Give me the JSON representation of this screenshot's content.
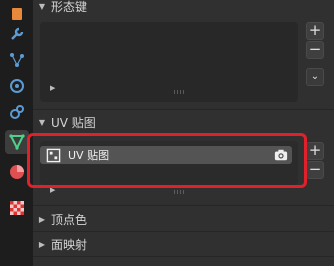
{
  "tabs": [
    {
      "name": "object-data-tab",
      "icon": "object-icon",
      "color": "#e8883a"
    },
    {
      "name": "modifiers-tab",
      "icon": "wrench-icon",
      "color": "#5b9bd5"
    },
    {
      "name": "particles-tab",
      "icon": "particles-icon",
      "color": "#5b9bd5"
    },
    {
      "name": "physics-tab",
      "icon": "physics-icon",
      "color": "#5b9bd5"
    },
    {
      "name": "constraints-tab",
      "icon": "constraint-icon",
      "color": "#5b9bd5"
    },
    {
      "name": "mesh-data-tab",
      "icon": "mesh-data-icon",
      "color": "#4fd18b",
      "active": true
    },
    {
      "name": "material-tab",
      "icon": "material-icon",
      "color": "#e05050"
    },
    {
      "name": "texture-tab",
      "icon": "texture-icon",
      "color": "#e05050"
    }
  ],
  "panels": {
    "shape_keys": {
      "title": "形态键"
    },
    "uv_maps": {
      "title": "UV 贴图",
      "items": [
        {
          "name": "UV 贴图"
        }
      ]
    },
    "vertex_colors": {
      "title": "顶点色"
    },
    "face_maps": {
      "title": "面映射"
    }
  },
  "buttons": {
    "add": "+",
    "remove": "−",
    "more": "⌄"
  },
  "colors": {
    "highlight": "#e0212b",
    "active_tab": "#4fd18b"
  }
}
